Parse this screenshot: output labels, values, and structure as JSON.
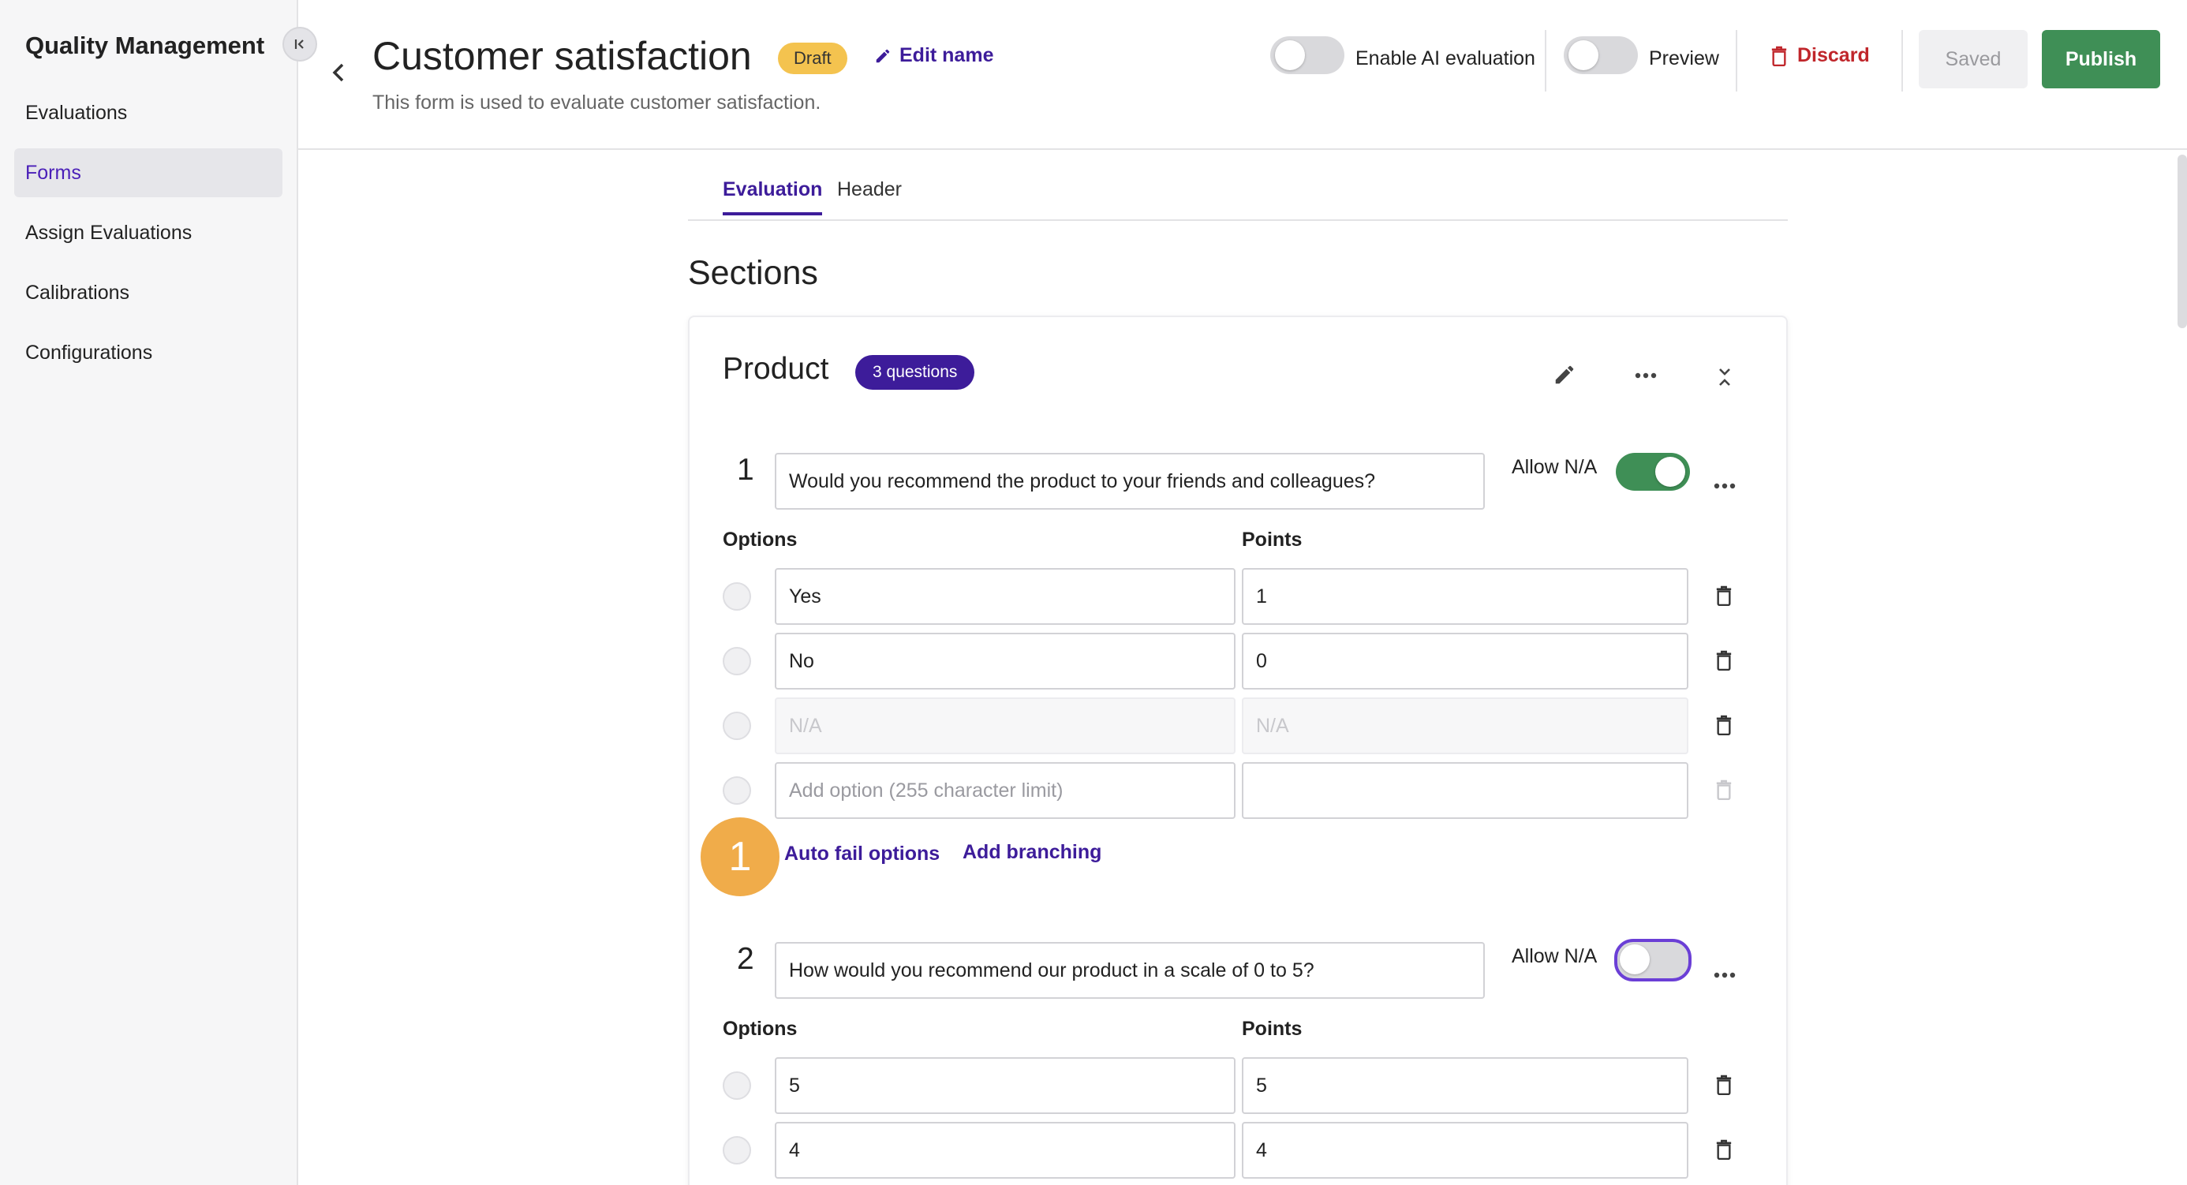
{
  "sidebar": {
    "app_title": "Quality Management",
    "nav": [
      {
        "label": "Evaluations",
        "active": false
      },
      {
        "label": "Forms",
        "active": true
      },
      {
        "label": "Assign Evaluations",
        "active": false
      },
      {
        "label": "Calibrations",
        "active": false
      },
      {
        "label": "Configurations",
        "active": false
      }
    ]
  },
  "header": {
    "title": "Customer satisfaction",
    "status_badge": "Draft",
    "edit_name_label": "Edit name",
    "description": "This form is used to evaluate customer satisfaction.",
    "ai_toggle_label": "Enable AI evaluation",
    "ai_toggle_on": false,
    "preview_label": "Preview",
    "preview_on": false,
    "discard_label": "Discard",
    "saved_label": "Saved",
    "publish_label": "Publish"
  },
  "tabs": [
    {
      "label": "Evaluation",
      "active": true
    },
    {
      "label": "Header",
      "active": false
    }
  ],
  "sections_title": "Sections",
  "section": {
    "name": "Product",
    "question_count": "3 questions",
    "questions": [
      {
        "number": "1",
        "text": "Would you recommend the product to your friends and colleagues?",
        "allow_na_label": "Allow N/A",
        "allow_na": true,
        "options_label": "Options",
        "points_label": "Points",
        "options": [
          {
            "option": "Yes",
            "points": "1"
          },
          {
            "option": "No",
            "points": "0"
          },
          {
            "option_placeholder": "N/A",
            "points_placeholder": "N/A"
          },
          {
            "option_placeholder": "Add option (255 character limit)",
            "points": ""
          }
        ],
        "links": {
          "auto_fail": "Auto fail options",
          "add_branching": "Add branching"
        }
      },
      {
        "number": "2",
        "text": "How would you recommend our product in a scale of 0 to 5?",
        "allow_na_label": "Allow N/A",
        "allow_na": false,
        "options_label": "Options",
        "points_label": "Points",
        "options": [
          {
            "option": "5",
            "points": "5"
          },
          {
            "option": "4",
            "points": "4"
          }
        ]
      }
    ]
  },
  "step_marker": "1",
  "colors": {
    "accent": "#3d1c9a",
    "primary_button": "#3f8f56",
    "danger": "#c0262b",
    "draft_badge": "#f4c34f",
    "step_marker": "#f0ac4a"
  },
  "icons": [
    "collapse-sidebar-icon",
    "back-icon",
    "pencil-icon",
    "trash-icon",
    "edit-icon",
    "more-icon",
    "collapse-icon"
  ]
}
